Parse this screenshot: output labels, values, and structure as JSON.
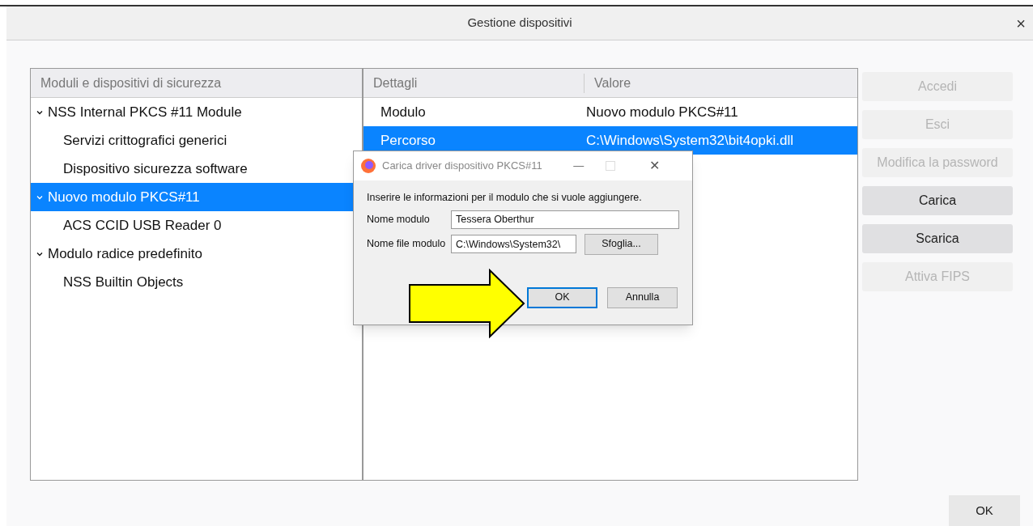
{
  "window": {
    "title": "Gestione dispositivi",
    "close": "×"
  },
  "modules": {
    "header": "Moduli e dispositivi di sicurezza",
    "items": [
      {
        "label": "NSS Internal PKCS #11 Module",
        "expanded": true,
        "selected": false,
        "children": [
          {
            "label": "Servizi crittografici generici",
            "selected": false
          },
          {
            "label": "Dispositivo sicurezza software",
            "selected": false
          }
        ]
      },
      {
        "label": "Nuovo modulo PKCS#11",
        "expanded": true,
        "selected": true,
        "children": [
          {
            "label": "ACS CCID USB Reader 0",
            "selected": false
          }
        ]
      },
      {
        "label": "Modulo radice predefinito",
        "expanded": true,
        "selected": false,
        "children": [
          {
            "label": "NSS Builtin Objects",
            "selected": false
          }
        ]
      }
    ]
  },
  "details": {
    "columns": [
      "Dettagli",
      "Valore"
    ],
    "rows": [
      {
        "cells": [
          "Modulo",
          "Nuovo modulo PKCS#11"
        ],
        "selected": false
      },
      {
        "cells": [
          "Percorso",
          "C:\\Windows\\System32\\bit4opki.dll"
        ],
        "selected": true
      }
    ]
  },
  "actions": [
    {
      "label": "Accedi",
      "disabled": true
    },
    {
      "label": "Esci",
      "disabled": true
    },
    {
      "label": "Modifica la password",
      "disabled": true
    },
    {
      "label": "Carica",
      "disabled": false
    },
    {
      "label": "Scarica",
      "disabled": false
    },
    {
      "label": "Attiva FIPS",
      "disabled": true
    }
  ],
  "ok_button": "OK",
  "load_dialog": {
    "title": "Carica driver dispositivo PKCS#11",
    "minimize": "—",
    "close": "✕",
    "prompt": "Inserire le informazioni per il modulo che si vuole aggiungere.",
    "fields": [
      {
        "label": "Nome modulo",
        "value": "Tessera Oberthur"
      },
      {
        "label": "Nome file modulo",
        "value": "C:\\Windows\\System32\\",
        "button": "Sfoglia..."
      }
    ],
    "buttons": [
      {
        "label": "OK",
        "default": true
      },
      {
        "label": "Annulla",
        "default": false
      }
    ]
  }
}
